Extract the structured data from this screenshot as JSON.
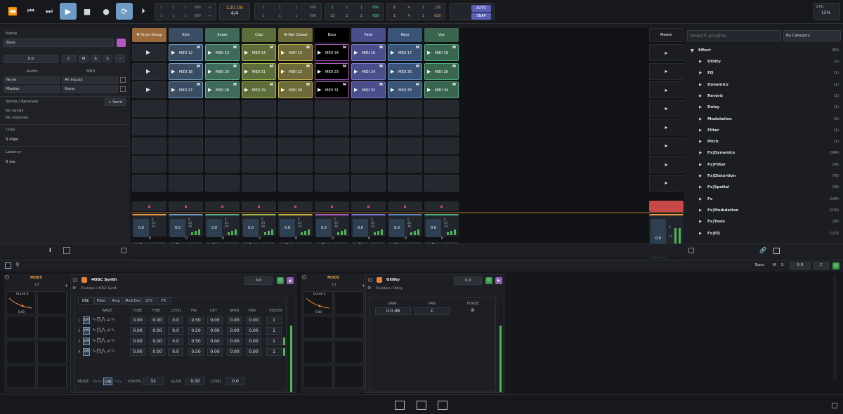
{
  "transport": {
    "tempo": "120.00",
    "signature": "4/4",
    "auto": "AUTO",
    "snap": "SNAP",
    "cpu_label": "CPU",
    "cpu_value": "15%",
    "pos1": [
      "1",
      "1",
      "1",
      "000"
    ],
    "pos2": [
      "1",
      "1",
      "1",
      "000"
    ],
    "pos3": [
      "1",
      "1",
      "1",
      "000"
    ],
    "loop1": [
      "1",
      "1",
      "1",
      "000"
    ],
    "loop2": [
      "1",
      "1",
      "1",
      "000"
    ],
    "loopin": [
      "1",
      "1",
      "1",
      "000"
    ],
    "loopout": [
      "32",
      "1",
      "1",
      "000"
    ],
    "punchin": [
      "8",
      "4",
      "1",
      "216"
    ],
    "punchout": [
      "1",
      "4",
      "1",
      "020"
    ]
  },
  "inspector": {
    "name_label": "Name",
    "name_value": "Bass",
    "color": "#b05ac0",
    "volume": "0.0",
    "pan": "C",
    "m": "M",
    "s": "S",
    "r": "R",
    "dash": "-",
    "audio_label": "Audio",
    "midi_label": "MIDI",
    "audio_in": "None",
    "midi_in": "All Inputs",
    "audio_out": "Master",
    "midi_out": "None",
    "sends_label": "Sends / Receives",
    "send_btn": "+ Send",
    "no_sends": "No sends",
    "no_receives": "No receives",
    "clips_label": "Clips",
    "clips_value": "5 clips",
    "latency_label": "Latency",
    "latency_value": "0 ms"
  },
  "tracks": [
    {
      "name": "▼ Drum Group",
      "color": "#9a6a3a",
      "hl": "#e89a4a",
      "clips": []
    },
    {
      "name": "Kick",
      "color": "#3a4d62",
      "hl": "#6f9cc5",
      "clips": [
        "MIDI 12",
        "MIDI 18",
        "MIDI 27"
      ]
    },
    {
      "name": "Snare",
      "color": "#3f6a5a",
      "hl": "#5fb08a",
      "clips": [
        "MIDI 13",
        "MIDI 20",
        "MIDI 28"
      ]
    },
    {
      "name": "Clap",
      "color": "#5e6e3a",
      "hl": "#a0b84a",
      "clips": [
        "MIDI 14",
        "MIDI 21",
        "MIDI 29"
      ]
    },
    {
      "name": "Hi-Hat Closed",
      "color": "#6e6a3a",
      "hl": "#c8b84a",
      "clips": [
        "MIDI 15",
        "MIDI 22",
        "MIDI 30"
      ]
    },
    {
      "name": "Bass",
      "color": "#000000",
      "hl": "#b05ac0",
      "clips": [
        "MIDI 34",
        "MIDI 23",
        "MIDI 31"
      ]
    },
    {
      "name": "Pads",
      "color": "#4a4e8a",
      "hl": "#7a7ad0",
      "clips": [
        "MIDI 16",
        "MIDI 24",
        "MIDI 32"
      ]
    },
    {
      "name": "Keys",
      "color": "#3a5478",
      "hl": "#5a8ac8",
      "clips": [
        "MIDI 17",
        "MIDI 25",
        "MIDI 33"
      ]
    },
    {
      "name": "Vox",
      "color": "#3a6650",
      "hl": "#4fb080",
      "clips": [
        "MIDI 18",
        "MIDI 26",
        "MIDI 34"
      ]
    }
  ],
  "mixer": {
    "vol": "0.0",
    "scale": [
      "0",
      "24",
      "48"
    ],
    "bottom": "0"
  },
  "master": {
    "name": "Master",
    "vol": "0.0",
    "scale": [
      "0",
      "24",
      "48"
    ]
  },
  "browser": {
    "search_placeholder": "Search plugins...",
    "sort": "By Category",
    "root": "Effect",
    "root_count": "(55)",
    "items": [
      [
        "Utility",
        "(2)"
      ],
      [
        "EQ",
        "(1)"
      ],
      [
        "Dynamics",
        "(1)"
      ],
      [
        "Reverb",
        "(1)"
      ],
      [
        "Delay",
        "(1)"
      ],
      [
        "Modulation",
        "(2)"
      ],
      [
        "Filter",
        "(1)"
      ],
      [
        "Pitch",
        "(1)"
      ],
      [
        "Fx|Dynamics",
        "(164)"
      ],
      [
        "Fx|Filter",
        "(34)"
      ],
      [
        "Fx|Distortion",
        "(70)"
      ],
      [
        "Fx|Spatial",
        "(18)"
      ],
      [
        "Fx",
        "(140)"
      ],
      [
        "Fx|Modulation",
        "(310)"
      ],
      [
        "Fx|Tools",
        "(28)"
      ],
      [
        "Fx|EQ",
        "(123)"
      ]
    ]
  },
  "devicebar": {
    "track": "Bass",
    "m": "M",
    "s": "S",
    "vol": "0.0",
    "pan": "C"
  },
  "devices": [
    {
      "mods": "MODS",
      "mods_sel": "1/1",
      "curve": "Curve 1",
      "curve_val": "0.00",
      "name": "4OSC Synth",
      "path": "Tracktion / 4OSC Synth",
      "vol": "0.0"
    },
    {
      "mods": "MODS",
      "mods_sel": "1/1",
      "curve": "Curve 1",
      "curve_val": "0.00",
      "name": "Utility",
      "path": "Tracktion / Utility",
      "vol": "0.0"
    }
  ],
  "synth": {
    "tabs": [
      "OSC",
      "Filter",
      "Amp",
      "Mod Env",
      "LFO",
      "FX"
    ],
    "cols": [
      "WAVE",
      "TUNE",
      "FINE",
      "LEVEL",
      "PW",
      "DET",
      "SPRD",
      "PAN",
      "VOICES"
    ],
    "rows": [
      {
        "n": "1",
        "off": "Off",
        "vals": [
          "0.00",
          "0.00",
          "0.0",
          "0.50",
          "0.00",
          "0.00",
          "0.00",
          "1"
        ]
      },
      {
        "n": "2",
        "off": "Off",
        "vals": [
          "0.00",
          "0.00",
          "0.0",
          "0.50",
          "0.00",
          "0.00",
          "0.00",
          "1"
        ]
      },
      {
        "n": "3",
        "off": "Off",
        "vals": [
          "0.00",
          "0.00",
          "0.0",
          "0.50",
          "0.00",
          "0.00",
          "0.00",
          "1"
        ]
      },
      {
        "n": "4",
        "off": "Off",
        "vals": [
          "0.00",
          "0.00",
          "0.0",
          "0.50",
          "0.00",
          "0.00",
          "0.00",
          "1"
        ]
      }
    ],
    "mode_label": "MODE",
    "mode_mono": "Mono",
    "mode_leg": "Leg",
    "mode_poly": "Poly",
    "voices_label": "VOICES",
    "voices": "32",
    "glide_label": "GLIDE",
    "glide": "0.00",
    "level_label": "LEVEL",
    "level": "0.0"
  },
  "utility": {
    "gain_label": "GAIN",
    "gain": "0.0 dB",
    "pan_label": "PAN",
    "pan": "C",
    "phase_label": "PHASE"
  }
}
